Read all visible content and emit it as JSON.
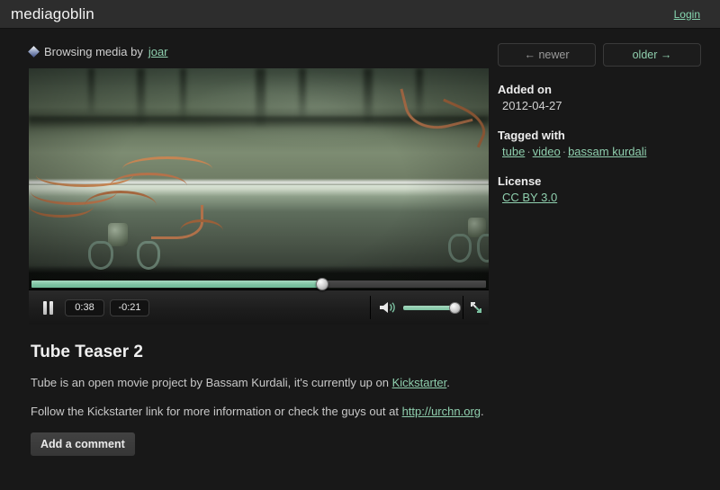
{
  "header": {
    "logo": "mediagoblin",
    "login_label": "Login"
  },
  "browsing": {
    "icon": "diamond-icon",
    "prefix": "Browsing media by",
    "user": "joar"
  },
  "player": {
    "play_state": "pause",
    "current_time": "0:38",
    "remaining_time": "-0:21",
    "progress_percent": 64,
    "volume_percent": 100,
    "pause_icon": "pause-icon",
    "speaker_icon": "speaker-icon",
    "fullscreen_icon": "fullscreen-icon"
  },
  "media": {
    "title": "Tube Teaser 2",
    "paragraph1_before": "Tube is an open movie project by Bassam Kurdali, it's currently up on ",
    "paragraph1_link": "Kickstarter",
    "paragraph1_after": ".",
    "paragraph2_before": "Follow the Kickstarter link for more information or check the guys out at ",
    "paragraph2_link": "http://urchn.org",
    "paragraph2_after": ".",
    "add_comment_label": "Add a comment"
  },
  "sidebar": {
    "newer_label": "← newer",
    "older_label": "older →",
    "added_on_head": "Added on",
    "added_on_value": "2012-04-27",
    "tagged_head": "Tagged with",
    "tags": [
      "tube",
      "video",
      "bassam kurdali"
    ],
    "license_head": "License",
    "license_value": "CC BY 3.0"
  },
  "colors": {
    "accent_green": "#8fcfae",
    "page_bg": "#181818",
    "header_bg": "#2d2d2d",
    "progress_green": "#7cc2a1"
  }
}
